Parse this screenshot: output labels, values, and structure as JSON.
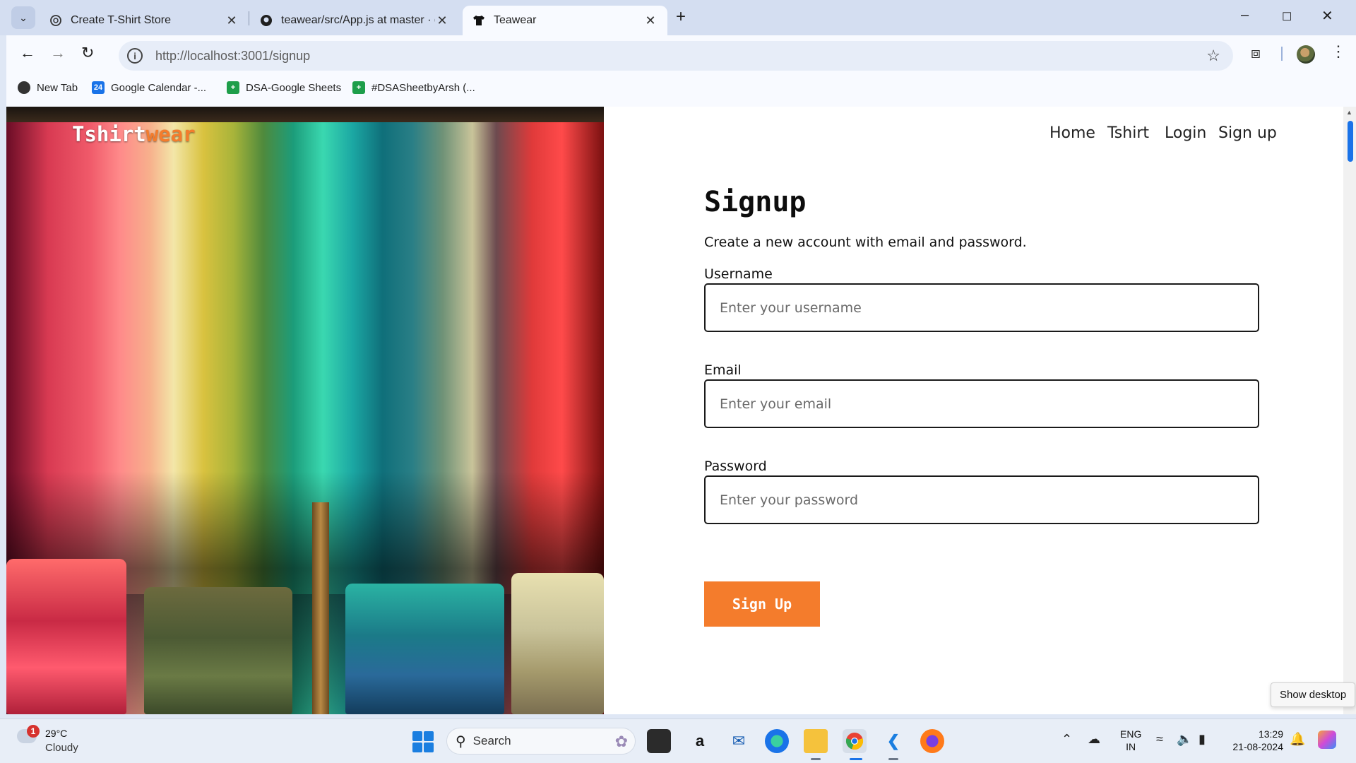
{
  "browser": {
    "tabs": [
      {
        "title": "Create T-Shirt Store",
        "icon": "openai-icon"
      },
      {
        "title": "teawear/src/App.js at master · g",
        "icon": "github-icon"
      },
      {
        "title": "Teawear",
        "icon": "tshirt-icon",
        "active": true
      }
    ],
    "url": "http://localhost:3001/signup",
    "bookmarks": [
      {
        "label": "New Tab",
        "icon": "globe-icon"
      },
      {
        "label": "Google Calendar -...",
        "icon": "calendar-icon",
        "badge": "24"
      },
      {
        "label": "DSA-Google Sheets",
        "icon": "sheets-icon"
      },
      {
        "label": "#DSASheetbyArsh (...",
        "icon": "sheets-icon"
      }
    ]
  },
  "site": {
    "logo_part1": "Tshirt",
    "logo_part2": "wear",
    "nav": [
      "Home",
      "Tshirt",
      "Login",
      "Sign up"
    ],
    "form": {
      "title": "Signup",
      "subtitle": "Create a new account with email and password.",
      "fields": [
        {
          "label": "Username",
          "placeholder": "Enter your username"
        },
        {
          "label": "Email",
          "placeholder": "Enter your email"
        },
        {
          "label": "Password",
          "placeholder": "Enter your password"
        }
      ],
      "submit_label": "Sign Up"
    },
    "accent_color": "#f47c2c"
  },
  "tooltip": "Show desktop",
  "taskbar": {
    "weather_badge": "1",
    "weather_temp": "29°C",
    "weather_desc": "Cloudy",
    "search_label": "Search",
    "lang_line1": "ENG",
    "lang_line2": "IN",
    "time": "13:29",
    "date": "21-08-2024"
  }
}
